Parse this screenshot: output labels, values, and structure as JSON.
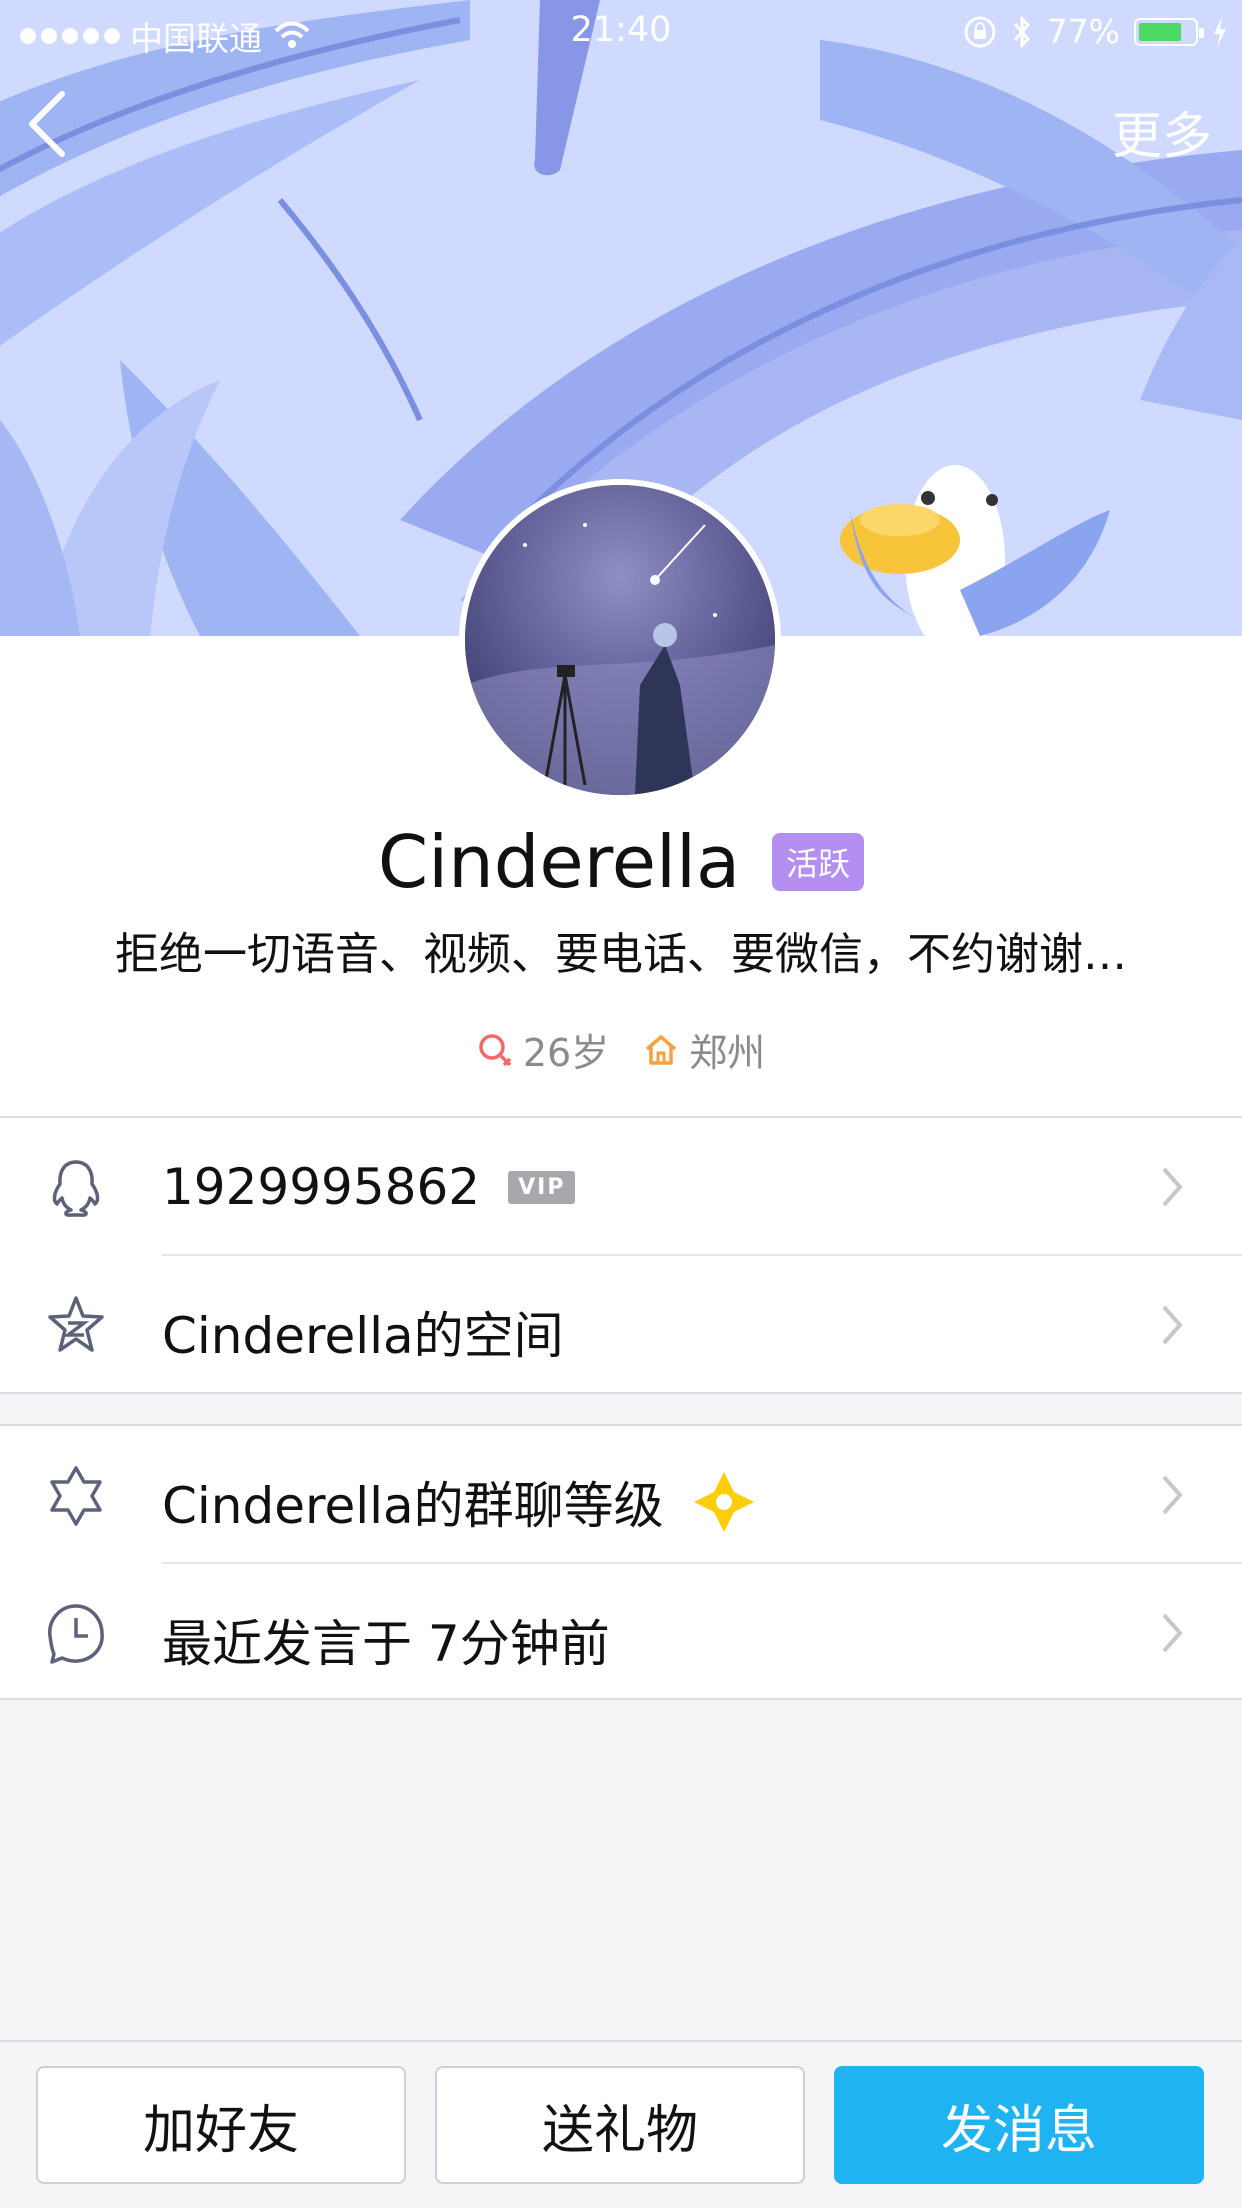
{
  "status_bar": {
    "carrier": "中国联通",
    "time": "21:40",
    "battery": "77%"
  },
  "nav": {
    "more": "更多"
  },
  "profile": {
    "name": "Cinderella",
    "badge": "活跃",
    "signature": "拒绝一切语音、视频、要电话、要微信，不约谢谢…",
    "age": "26岁",
    "city": "郑州"
  },
  "list": {
    "qq": {
      "number": "1929995862",
      "badge": "VIP"
    },
    "space": {
      "label": "Cinderella的空间"
    },
    "group_level": {
      "label": "Cinderella的群聊等级"
    },
    "last_post": {
      "label": "最近发言于 7分钟前"
    }
  },
  "bottom": {
    "add_friend": "加好友",
    "send_gift": "送礼物",
    "send_message": "发消息"
  },
  "colors": {
    "accent_blue": "#1fb4f1",
    "badge_purple": "#b48ef0",
    "banner_bg": "#c9d6ff"
  }
}
